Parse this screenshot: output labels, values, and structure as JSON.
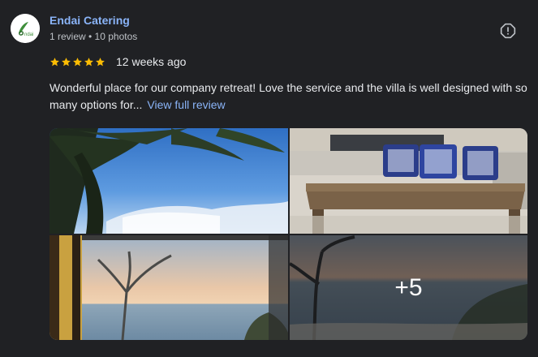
{
  "reviewer": {
    "name": "Endai Catering",
    "meta": "1 review • 10 photos",
    "avatar_icon": "endai-logo-icon",
    "avatar_text": "ndai"
  },
  "review": {
    "rating": 5,
    "rating_max": 5,
    "date": "12 weeks ago",
    "text": "Wonderful place for our company retreat! Love the service and the villa is well designed with so many options for...",
    "view_full_label": "View full review"
  },
  "photos": {
    "items": [
      {
        "name": "palm-tree-sky-photo"
      },
      {
        "name": "wooden-bench-cushions-photo"
      },
      {
        "name": "sunset-sea-view-photo"
      },
      {
        "name": "dusk-sea-photo"
      }
    ],
    "more_count_label": "+5"
  },
  "icons": {
    "more": "report-icon",
    "star": "star-icon"
  },
  "colors": {
    "background": "#202124",
    "link": "#8ab4f8",
    "star": "#fbbc04",
    "text": "#e8eaed",
    "secondary_text": "#bdc1c6"
  }
}
